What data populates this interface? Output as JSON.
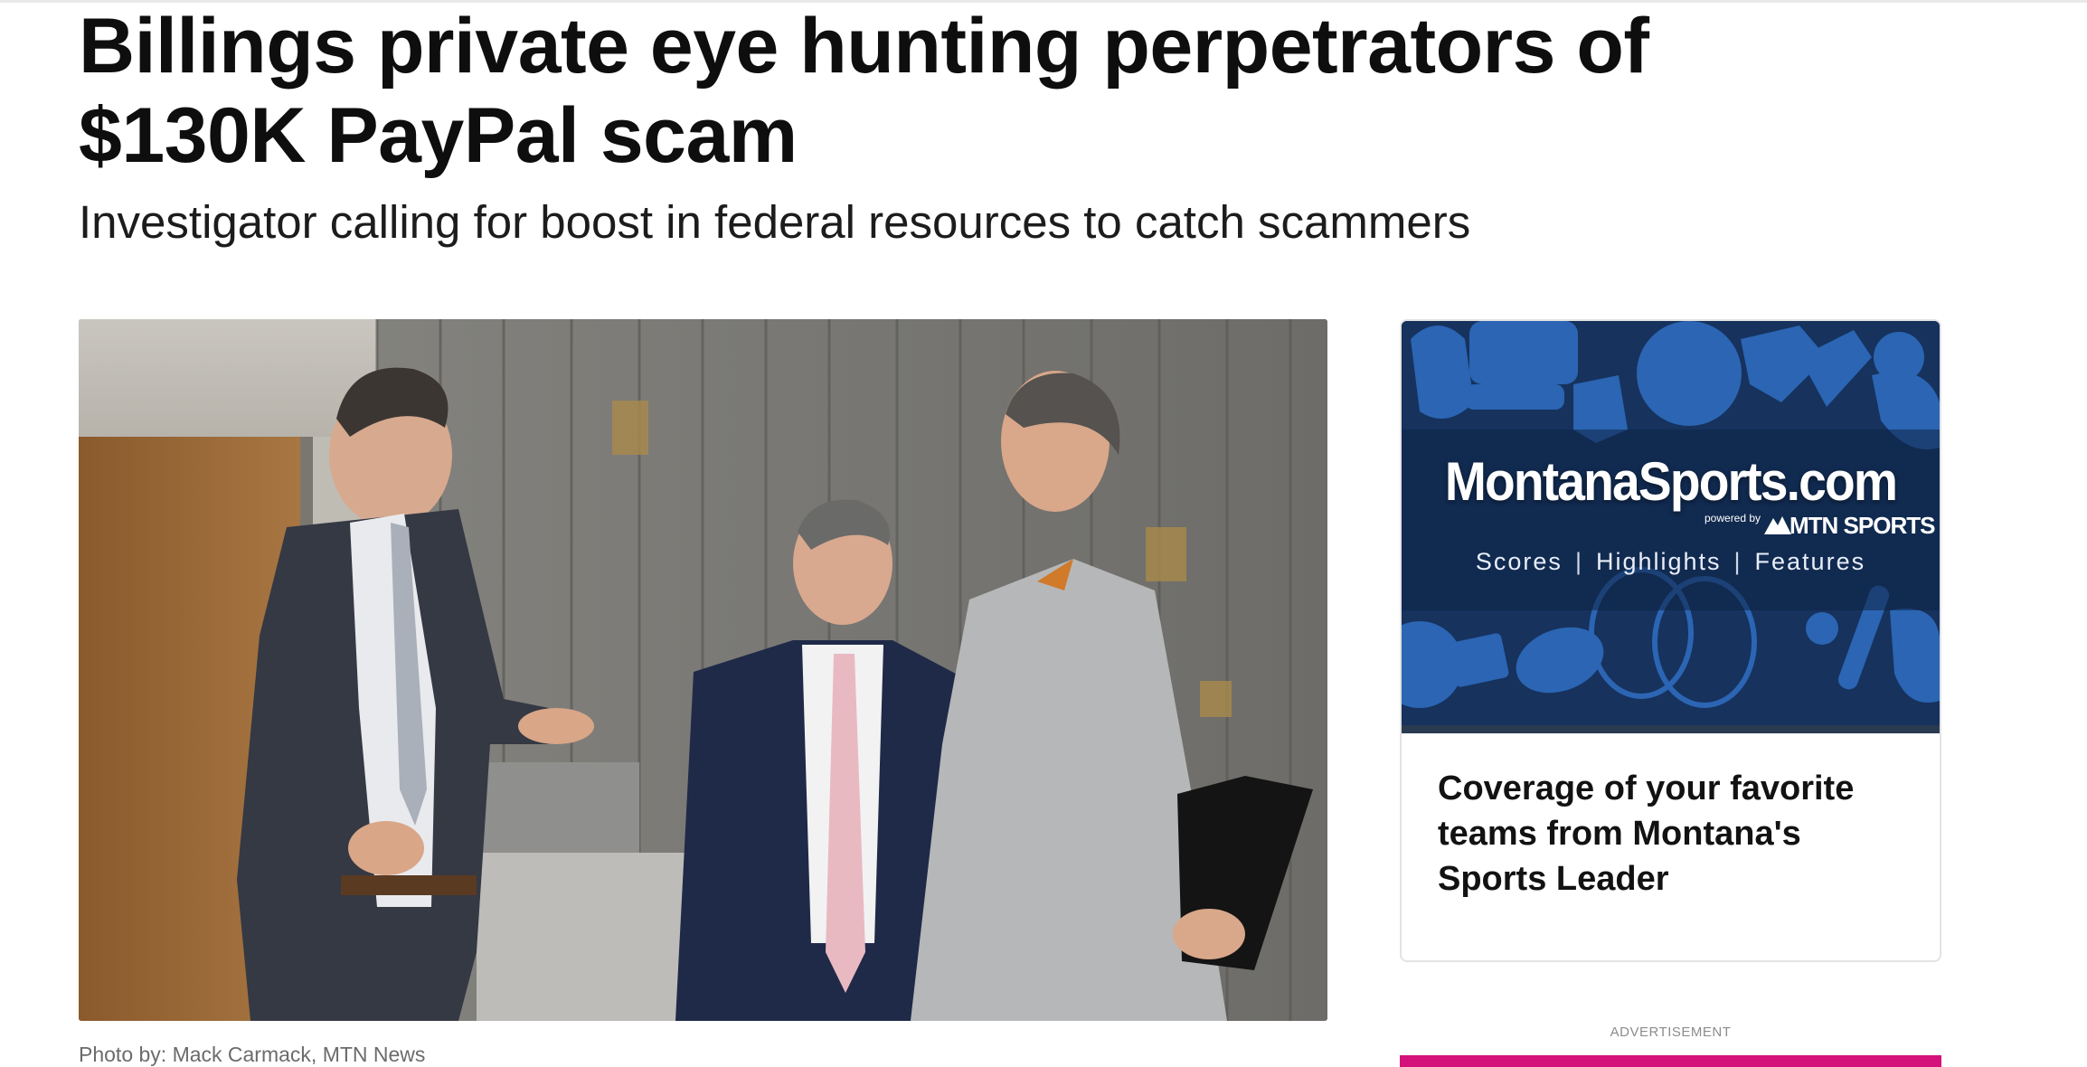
{
  "article": {
    "headline": "Billings private eye hunting perpetrators of $130K PayPal scam",
    "subheadline": "Investigator calling for boost in federal resources to catch scammers",
    "photo_credit": "Photo by: Mack Carmack, MTN News"
  },
  "promo": {
    "brand": "MontanaSports.com",
    "powered_by": "powered by",
    "network": "MTN SPORTS",
    "tagline_items": [
      "Scores",
      "Highlights",
      "Features"
    ],
    "separator": "|",
    "caption": "Coverage of your favorite teams from Montana's Sports Leader"
  },
  "advertisement": {
    "label": "ADVERTISEMENT"
  },
  "colors": {
    "promo_blue": "#1b3a6a",
    "ad_strip": "#d4127c"
  }
}
